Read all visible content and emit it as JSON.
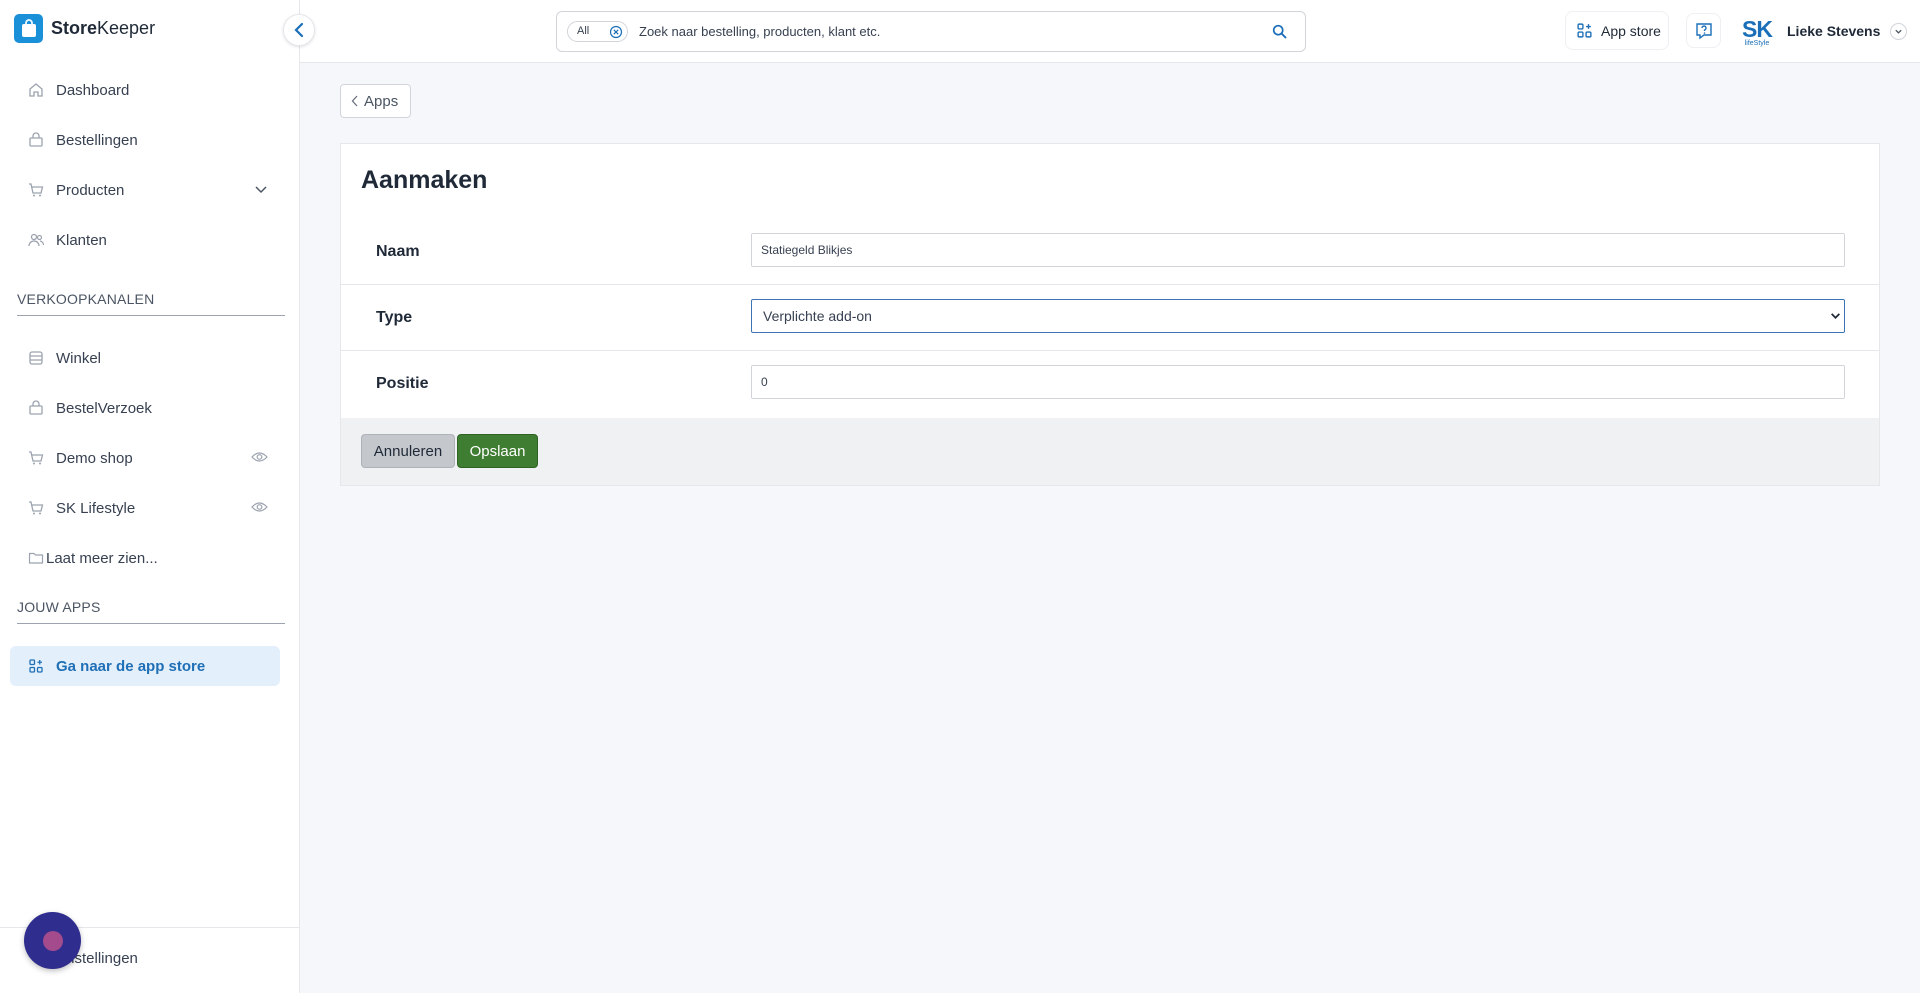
{
  "brand": {
    "name_bold": "Store",
    "name_rest": "Keeper"
  },
  "sidebar": {
    "items": [
      {
        "label": "Dashboard",
        "icon": "home-icon"
      },
      {
        "label": "Bestellingen",
        "icon": "shopping-bag-icon"
      },
      {
        "label": "Producten",
        "icon": "cart-icon",
        "expandable": true
      },
      {
        "label": "Klanten",
        "icon": "users-icon"
      }
    ],
    "sales_channels_heading": "VERKOOPKANALEN",
    "sales_channels": [
      {
        "label": "Winkel",
        "icon": "store-icon"
      },
      {
        "label": "BestelVerzoek",
        "icon": "shopping-bag-icon"
      },
      {
        "label": "Demo shop",
        "icon": "cart-icon",
        "visibility": "eye-icon"
      },
      {
        "label": "SK Lifestyle",
        "icon": "cart-icon",
        "visibility": "eye-icon"
      }
    ],
    "show_more": "Laat meer zien...",
    "apps_heading": "JOUW APPS",
    "app_store_link": "Ga naar de app store",
    "footer_label": "Instellingen"
  },
  "topbar": {
    "search_scope": "All",
    "search_placeholder": "Zoek naar bestelling, producten, klant etc.",
    "app_store_label": "App store",
    "user_logo_text": "SK",
    "user_logo_sub": "lifeStyle",
    "user_name": "Lieke Stevens"
  },
  "main": {
    "back_label": "Apps",
    "title": "Aanmaken",
    "fields": [
      {
        "label": "Naam",
        "value": "Statiegeld Blikjes",
        "kind": "text"
      },
      {
        "label": "Type",
        "value": "Verplichte add-on",
        "kind": "select"
      },
      {
        "label": "Positie",
        "value": "0",
        "kind": "text"
      }
    ],
    "cancel_label": "Annuleren",
    "save_label": "Opslaan"
  },
  "colors": {
    "accent": "#1a90d8",
    "active_bg": "#e3effb",
    "save_green": "#3f7d32",
    "chat_bubble": "#2f2d8e"
  }
}
